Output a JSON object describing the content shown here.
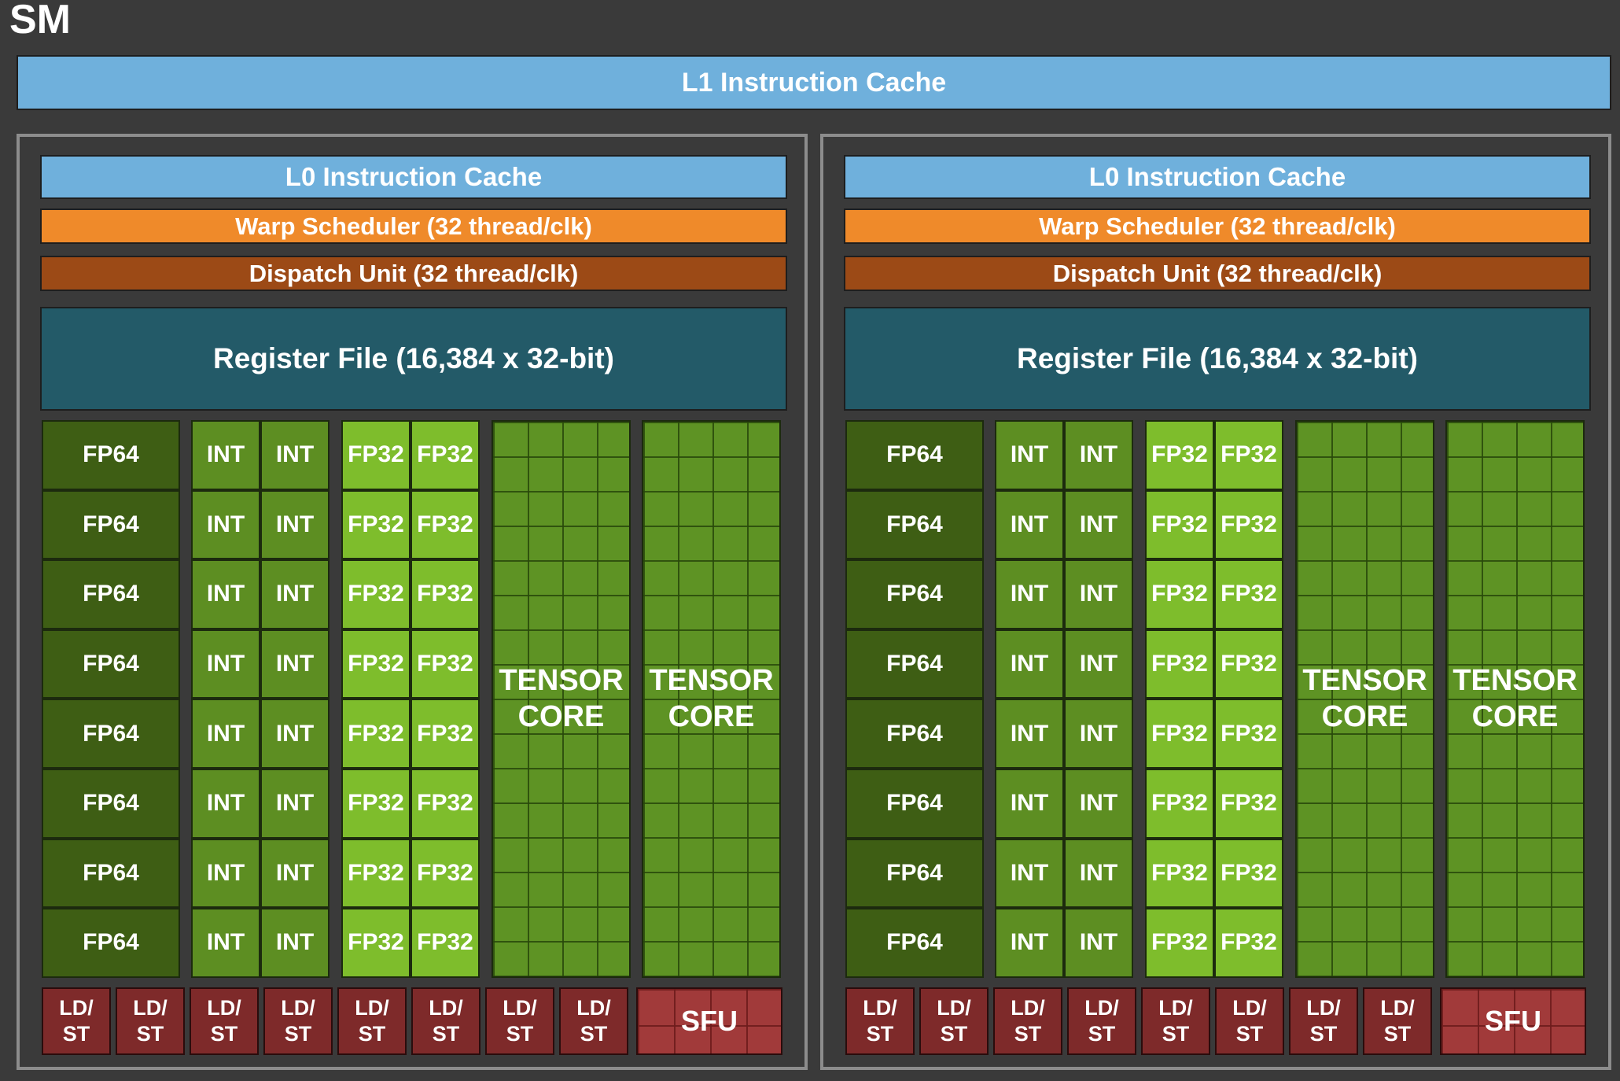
{
  "title": "SM",
  "l1_cache": "L1 Instruction Cache",
  "partition": {
    "l0_cache": "L0 Instruction Cache",
    "warp_scheduler": "Warp Scheduler (32 thread/clk)",
    "dispatch_unit": "Dispatch Unit (32 thread/clk)",
    "register_file": "Register File (16,384 x 32-bit)",
    "fp64_label": "FP64",
    "int_label": "INT",
    "fp32_label": "FP32",
    "tensor_line1": "TENSOR",
    "tensor_line2": "CORE",
    "ldst_line1": "LD/",
    "ldst_line2": "ST",
    "sfu_label": "SFU",
    "rows": 8,
    "ldst_units": 8,
    "tensor_cores": 2
  },
  "partitions_count": 2,
  "colors": {
    "background": "#3a3a3a",
    "cache": "#6fb0dc",
    "warp_scheduler": "#ef8a2a",
    "dispatch_unit": "#9c4a16",
    "register_file": "#235a68",
    "fp64": "#3e5e14",
    "int": "#5d8e22",
    "fp32": "#7ebd2c",
    "tensor_core": "#5e9324",
    "ldst": "#7e2a2a",
    "sfu": "#a13a3a"
  }
}
